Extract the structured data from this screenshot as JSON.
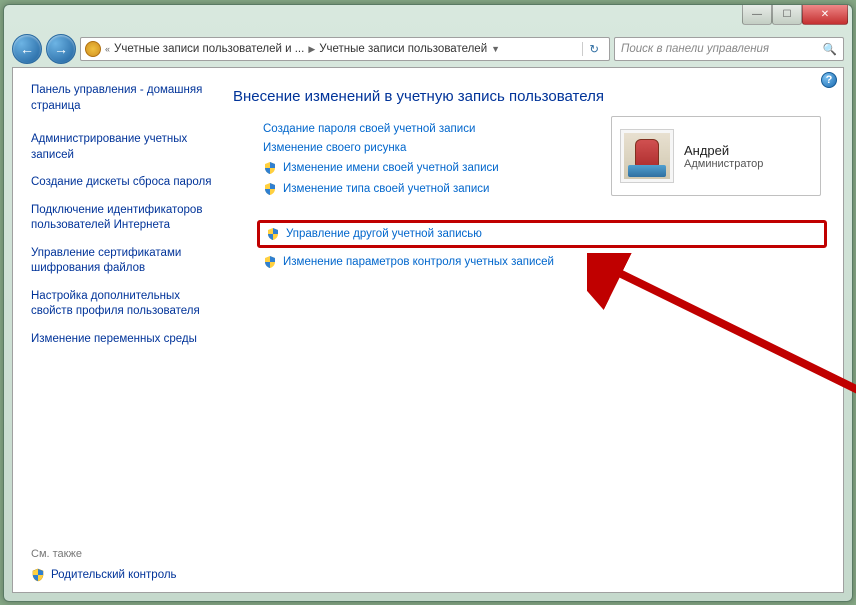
{
  "titlebar": {
    "minimize": "—",
    "maximize": "☐",
    "close": "✕"
  },
  "nav": {
    "back": "←",
    "forward": "→",
    "breadcrumb_prefix": "«",
    "breadcrumb_part1": "Учетные записи пользователей и ...",
    "breadcrumb_part2": "Учетные записи пользователей",
    "refresh": "↻",
    "search_placeholder": "Поиск в панели управления",
    "search_icon": "🔍"
  },
  "sidebar": {
    "home": "Панель управления - домашняя страница",
    "links": [
      "Администрирование учетных записей",
      "Создание дискеты сброса пароля",
      "Подключение идентификаторов пользователей Интернета",
      "Управление сертификатами шифрования файлов",
      "Настройка дополнительных свойств профиля пользователя",
      "Изменение переменных среды"
    ],
    "see_also": "См. также",
    "parental": "Родительский контроль"
  },
  "main": {
    "heading": "Внесение изменений в учетную запись пользователя",
    "actions_top": [
      {
        "label": "Создание пароля своей учетной записи",
        "shield": false
      },
      {
        "label": "Изменение своего рисунка",
        "shield": false
      },
      {
        "label": "Изменение имени своей учетной записи",
        "shield": true
      },
      {
        "label": "Изменение типа своей учетной записи",
        "shield": true
      }
    ],
    "action_highlight": {
      "label": "Управление другой учетной записью",
      "shield": true
    },
    "action_bottom": {
      "label": "Изменение параметров контроля учетных записей",
      "shield": true
    }
  },
  "user": {
    "name": "Андрей",
    "role": "Администратор"
  },
  "help": "?"
}
